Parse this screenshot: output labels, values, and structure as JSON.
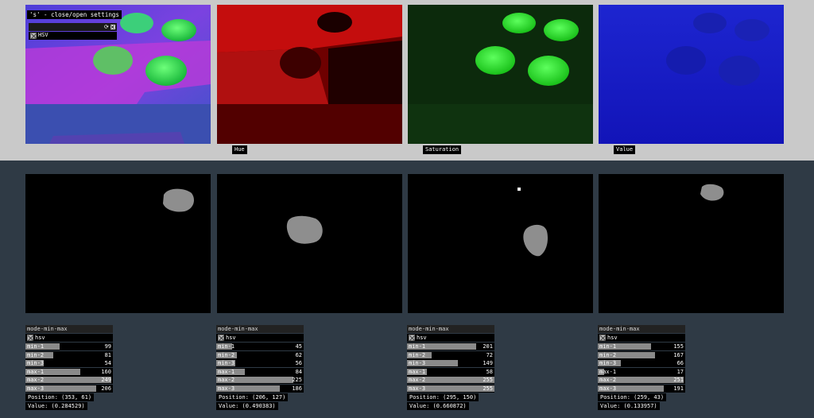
{
  "top": {
    "overlay_title": "'s' - close/open settings",
    "overlay_checkbox_label": "HSV",
    "captions": [
      "Hue",
      "Saturation",
      "Value"
    ]
  },
  "controls": [
    {
      "title": "mode-min-max",
      "mode_label": "hsv",
      "rows": [
        {
          "label": "min-1",
          "value": "99",
          "level": 0.39
        },
        {
          "label": "min-2",
          "value": "81",
          "level": 0.32
        },
        {
          "label": "min-3",
          "value": "54",
          "level": 0.21
        },
        {
          "label": "max-1",
          "value": "160",
          "level": 0.63
        },
        {
          "label": "max-2",
          "value": "249",
          "level": 0.98
        },
        {
          "label": "max-3",
          "value": "206",
          "level": 0.81
        }
      ],
      "position": "Position: (353, 61)",
      "value": "Value: (0.284529)"
    },
    {
      "title": "mode-min-max",
      "mode_label": "hsv",
      "rows": [
        {
          "label": "min-1",
          "value": "45",
          "level": 0.18
        },
        {
          "label": "min-2",
          "value": "62",
          "level": 0.24
        },
        {
          "label": "min-3",
          "value": "56",
          "level": 0.22
        },
        {
          "label": "max-1",
          "value": "84",
          "level": 0.33
        },
        {
          "label": "max-2",
          "value": "225",
          "level": 0.88
        },
        {
          "label": "max-3",
          "value": "186",
          "level": 0.73
        }
      ],
      "position": "Position: (206, 127)",
      "value": "Value: (0.490383)"
    },
    {
      "title": "mode-min-max",
      "mode_label": "hsv",
      "rows": [
        {
          "label": "min-1",
          "value": "201",
          "level": 0.79
        },
        {
          "label": "min-2",
          "value": "72",
          "level": 0.28
        },
        {
          "label": "min-3",
          "value": "149",
          "level": 0.58
        },
        {
          "label": "max-1",
          "value": "58",
          "level": 0.23
        },
        {
          "label": "max-2",
          "value": "255",
          "level": 1.0
        },
        {
          "label": "max-3",
          "value": "255",
          "level": 1.0
        }
      ],
      "position": "Position: (295, 150)",
      "value": "Value: (0.660872)"
    },
    {
      "title": "mode-min-max",
      "mode_label": "hsv",
      "rows": [
        {
          "label": "min-1",
          "value": "155",
          "level": 0.61
        },
        {
          "label": "min-2",
          "value": "167",
          "level": 0.65
        },
        {
          "label": "min-3",
          "value": "66",
          "level": 0.26
        },
        {
          "label": "max-1",
          "value": "17",
          "level": 0.07
        },
        {
          "label": "max-2",
          "value": "251",
          "level": 0.98
        },
        {
          "label": "max-3",
          "value": "191",
          "level": 0.75
        }
      ],
      "position": "Position: (259, 43)",
      "value": "Value: (0.133957)"
    }
  ],
  "colors": {
    "top_background": "#c9c9c9",
    "bottom_background": "#2f3a45",
    "bar_fill": "#8a8a8a"
  }
}
